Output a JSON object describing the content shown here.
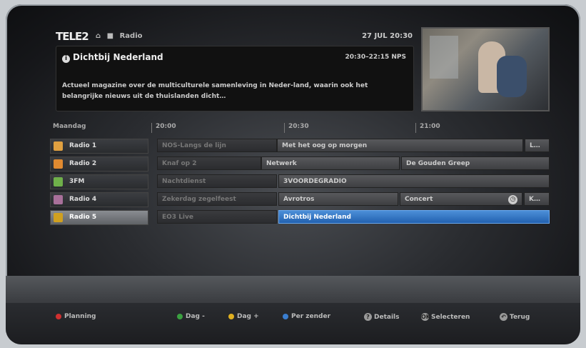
{
  "header": {
    "logo": "TELE2",
    "breadcrumb": [
      "⌂",
      "■",
      "Radio"
    ],
    "datetime": "27 JUL 20:30"
  },
  "info": {
    "title": "Dichtbij Nederland",
    "time": "20:30–22:15 NPS",
    "description": "Actueel magazine over de multiculturele samenleving in Neder-land, waarin ook het belangrijke nieuws uit de thuislanden dicht…"
  },
  "grid": {
    "day": "Maandag",
    "times": [
      "20:00",
      "20:30",
      "21:00"
    ],
    "channels": [
      {
        "name": "Radio 1",
        "color": "#e0a040"
      },
      {
        "name": "Radio 2",
        "color": "#e08a30"
      },
      {
        "name": "3FM",
        "color": "#6fb04a"
      },
      {
        "name": "Radio 4",
        "color": "#a8709a"
      },
      {
        "name": "Radio 5",
        "color": "#d0a020"
      }
    ],
    "programs": {
      "r1": [
        "NOS-Langs de lijn",
        "Met het oog op morgen",
        "L…"
      ],
      "r2": [
        "Knaf op 2",
        "Netwerk",
        "De Gouden Greep"
      ],
      "r3": [
        "Nachtdienst",
        "3VOORDEGRADIO"
      ],
      "r4": [
        "Zekerdag zegelfeest",
        "Avrotros",
        "Concert",
        "K…"
      ],
      "r5": [
        "EO3 Live",
        "Dichtbij Nederland"
      ]
    }
  },
  "footer": {
    "planning": "Planning",
    "day_minus": "Dag -",
    "day_plus": "Dag +",
    "per_channel": "Per zender",
    "details": "Details",
    "select": "Selecteren",
    "back": "Terug"
  },
  "colors": {
    "red": "#d03030",
    "green": "#3aa040",
    "yellow": "#e0b020",
    "blue": "#3a7ed0",
    "focus": "#2b6cc0"
  }
}
